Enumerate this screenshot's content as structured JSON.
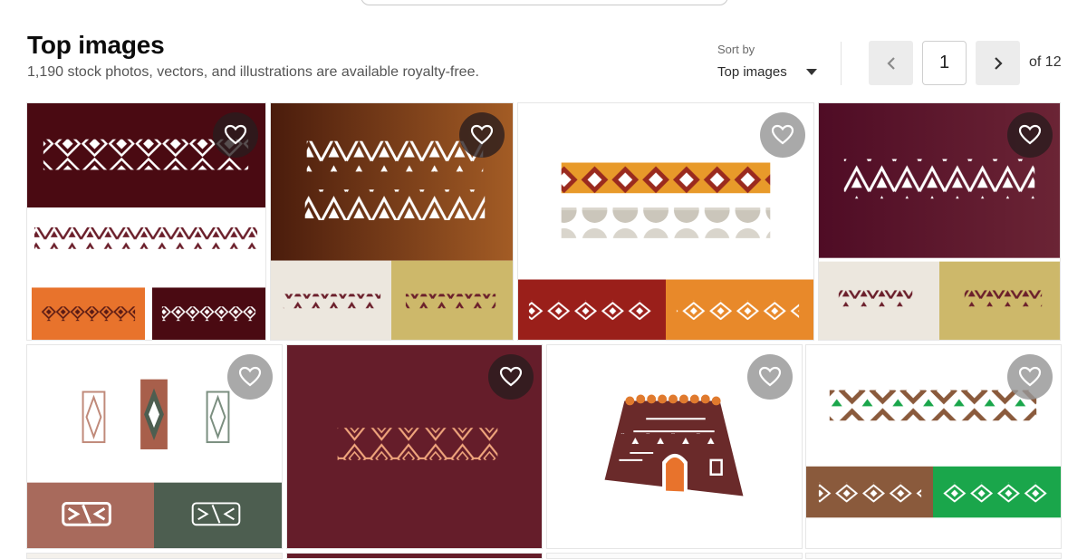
{
  "header": {
    "title": "Top images",
    "subtitle": "1,190 stock photos, vectors, and illustrations are available royalty-free."
  },
  "sort": {
    "label": "Sort by",
    "selected": "Top images"
  },
  "pagination": {
    "prev_icon": "chevron-left-icon",
    "next_icon": "chevron-right-icon",
    "current_page": "1",
    "of_label": "of 12"
  },
  "colors": {
    "maroon": "#4a0a12",
    "wine": "#6b1f2b",
    "brown": "#8b4513",
    "orange": "#e8732c",
    "gold": "#cdb86a",
    "cream": "#ece7de",
    "green": "#1aa64b",
    "slate": "#4d5e50",
    "rose": "#a86a5c"
  },
  "results": [
    {
      "id": "r1",
      "favorite_icon": "heart-icon"
    },
    {
      "id": "r2",
      "favorite_icon": "heart-icon"
    },
    {
      "id": "r3",
      "favorite_icon": "heart-icon"
    },
    {
      "id": "r4",
      "favorite_icon": "heart-icon"
    },
    {
      "id": "r5",
      "favorite_icon": "heart-icon"
    },
    {
      "id": "r6",
      "favorite_icon": "heart-icon"
    },
    {
      "id": "r7",
      "favorite_icon": "heart-icon"
    },
    {
      "id": "r8",
      "favorite_icon": "heart-icon"
    }
  ]
}
